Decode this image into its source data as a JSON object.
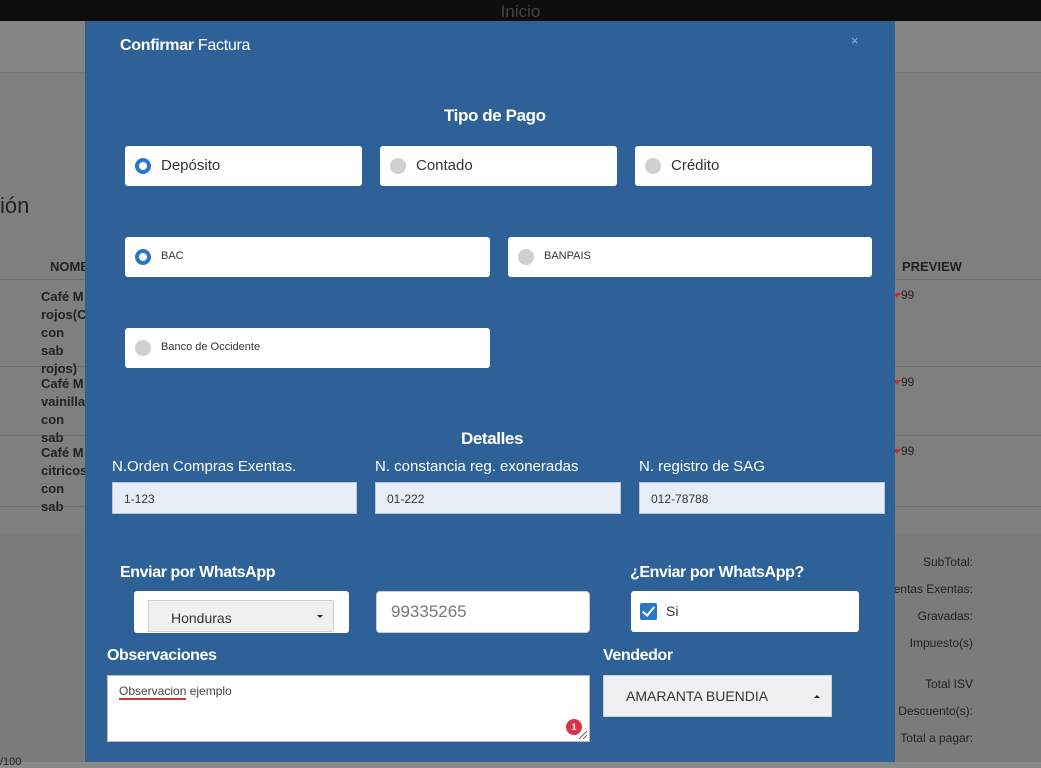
{
  "topbar": {
    "title": "Inicio"
  },
  "background": {
    "section_title_fragment": "ión",
    "columns": {
      "name": "NOMB",
      "preview": "PREVIEW"
    },
    "products": [
      {
        "name": "Café M\nrojos(C\ncon sab\nrojos)",
        "price": "99"
      },
      {
        "name": "Café M\nvainilla\ncon sab",
        "price": "99"
      },
      {
        "name": "Café M\ncitricos\ncon sab",
        "price": "99"
      }
    ],
    "summary": {
      "subtotal": "SubTotal:",
      "ventas_exentas": "entas Exentas:",
      "gravadas": "Gravadas:",
      "impuesto": "Impuesto(s)",
      "total_isv": "Total ISV",
      "descuento": "Descuento(s):",
      "total_pagar": "Total a pagar:"
    },
    "bottom_text": "/100"
  },
  "modal": {
    "title_bold": "Confirmar",
    "title_rest": "Factura",
    "close": "×",
    "payment": {
      "title": "Tipo de Pago",
      "options": [
        {
          "label": "Depósito",
          "selected": true
        },
        {
          "label": "Contado",
          "selected": false
        },
        {
          "label": "Crédito",
          "selected": false
        }
      ],
      "banks": [
        {
          "label": "BAC",
          "selected": true
        },
        {
          "label": "BANPAIS",
          "selected": false
        },
        {
          "label": "Banco de Occidente",
          "selected": false
        }
      ]
    },
    "details": {
      "title": "Detalles",
      "fields": [
        {
          "label": "N.Orden Compras Exentas.",
          "value": "1-123"
        },
        {
          "label": "N. constancia reg. exoneradas",
          "value": "01-222"
        },
        {
          "label": "N. registro de SAG",
          "value": "012-78788"
        }
      ]
    },
    "whatsapp": {
      "label": "Enviar por WhatsApp",
      "country": "Honduras",
      "phone": "99335265",
      "confirm_label": "¿Enviar por WhatsApp?",
      "confirm_value": "Si",
      "confirm_checked": true
    },
    "observations": {
      "label": "Observaciones",
      "word1": "Observacion",
      "word2": " ejemplo",
      "badge": "1"
    },
    "seller": {
      "label": "Vendedor",
      "value": "AMARANTA BUENDIA"
    }
  },
  "colors": {
    "modal_bg": "#2e6197",
    "radio_on": "#2b77c7",
    "badge": "#d9334a"
  }
}
